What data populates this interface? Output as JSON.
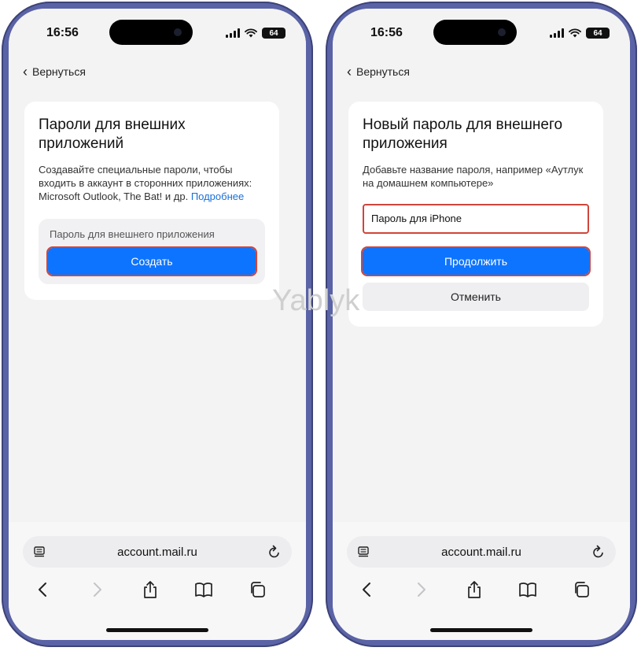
{
  "watermark": "Yablyk",
  "left_screen": {
    "status": {
      "time": "16:56",
      "battery": "64"
    },
    "back_label": "Вернуться",
    "card": {
      "title": "Пароли для внешних приложений",
      "description": "Создавайте специальные пароли, чтобы входить в аккаунт в сторонних приложениях: Microsoft Outlook, The Bat! и др.",
      "more_link": "Подробнее",
      "panel_label": "Пароль для внешнего приложения",
      "create_button": "Создать"
    },
    "browser": {
      "url": "account.mail.ru"
    }
  },
  "right_screen": {
    "status": {
      "time": "16:56",
      "battery": "64"
    },
    "back_label": "Вернуться",
    "card": {
      "title": "Новый пароль для внешнего приложения",
      "description": "Добавьте название пароля, например «Аутлук на домашнем компьютере»",
      "input_value": "Пароль для iPhone",
      "continue_button": "Продолжить",
      "cancel_button": "Отменить"
    },
    "browser": {
      "url": "account.mail.ru"
    }
  },
  "colors": {
    "primary_button": "#0d74ff",
    "highlight_outline": "#d0453a",
    "link": "#1a6fd8",
    "phone_frame": "#5a63a6"
  }
}
